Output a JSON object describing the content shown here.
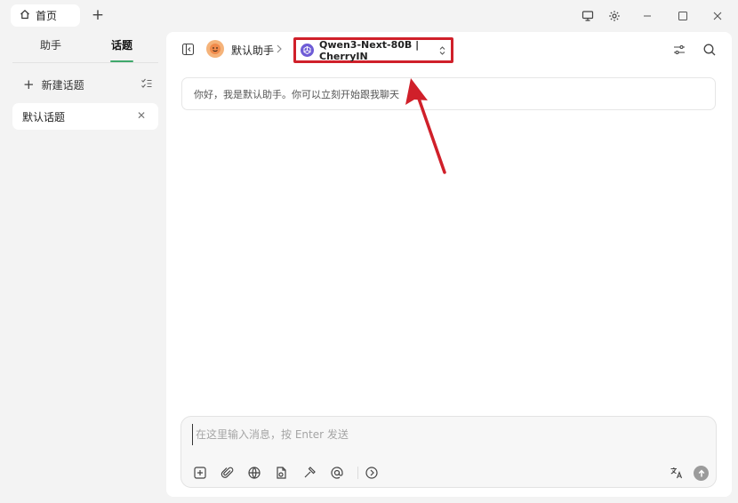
{
  "tabs": {
    "home_label": "首页"
  },
  "sidebar": {
    "segments": {
      "assistant": "助手",
      "topic": "话题"
    },
    "new_topic_label": "新建话题",
    "topics": [
      {
        "label": "默认话题"
      }
    ]
  },
  "navbar": {
    "assistant_name": "默认助手",
    "model_label": "Qwen3-Next-80B | CherryIN"
  },
  "chat": {
    "greeting": "你好，我是默认助手。你可以立刻开始跟我聊天"
  },
  "input": {
    "placeholder": "在这里输入消息，按 Enter 发送",
    "value": ""
  },
  "colors": {
    "accent": "#3fa86b",
    "highlight_box": "#d0202a",
    "annotation_arrow": "#d0202a",
    "model_logo": "#6e5cd6"
  }
}
